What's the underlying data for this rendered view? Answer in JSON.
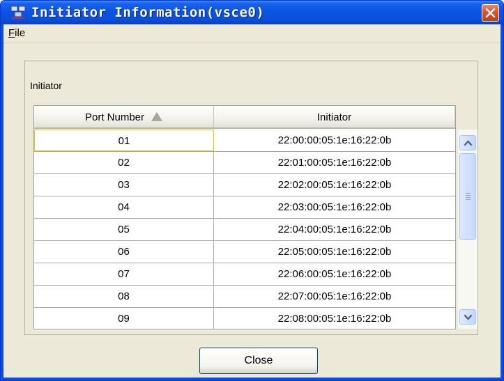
{
  "window": {
    "title": "Initiator Information(vsce0)"
  },
  "menu": {
    "file_accel": "F",
    "file_rest": "ile"
  },
  "group": {
    "label": "Initiator"
  },
  "table": {
    "columns": [
      "Port Number",
      "Initiator"
    ],
    "sorted_column": "Port Number",
    "sort_direction": "ascending",
    "rows": [
      {
        "port": "01",
        "initiator": "22:00:00:05:1e:16:22:0b"
      },
      {
        "port": "02",
        "initiator": "22:01:00:05:1e:16:22:0b"
      },
      {
        "port": "03",
        "initiator": "22:02:00:05:1e:16:22:0b"
      },
      {
        "port": "04",
        "initiator": "22:03:00:05:1e:16:22:0b"
      },
      {
        "port": "05",
        "initiator": "22:04:00:05:1e:16:22:0b"
      },
      {
        "port": "06",
        "initiator": "22:05:00:05:1e:16:22:0b"
      },
      {
        "port": "07",
        "initiator": "22:06:00:05:1e:16:22:0b"
      },
      {
        "port": "08",
        "initiator": "22:07:00:05:1e:16:22:0b"
      },
      {
        "port": "09",
        "initiator": "22:08:00:05:1e:16:22:0b"
      }
    ]
  },
  "buttons": {
    "close_label": "Close"
  },
  "icons": {
    "app": "network-icon",
    "window_close": "close-icon",
    "sort": "sort-ascending-icon",
    "scroll_up": "chevron-up-icon",
    "scroll_down": "chevron-down-icon"
  },
  "colors": {
    "titlebar": "#0a54e2",
    "close_button": "#d8532a",
    "dialog_bg": "#ece9d8",
    "focus_border": "#e6c800"
  }
}
